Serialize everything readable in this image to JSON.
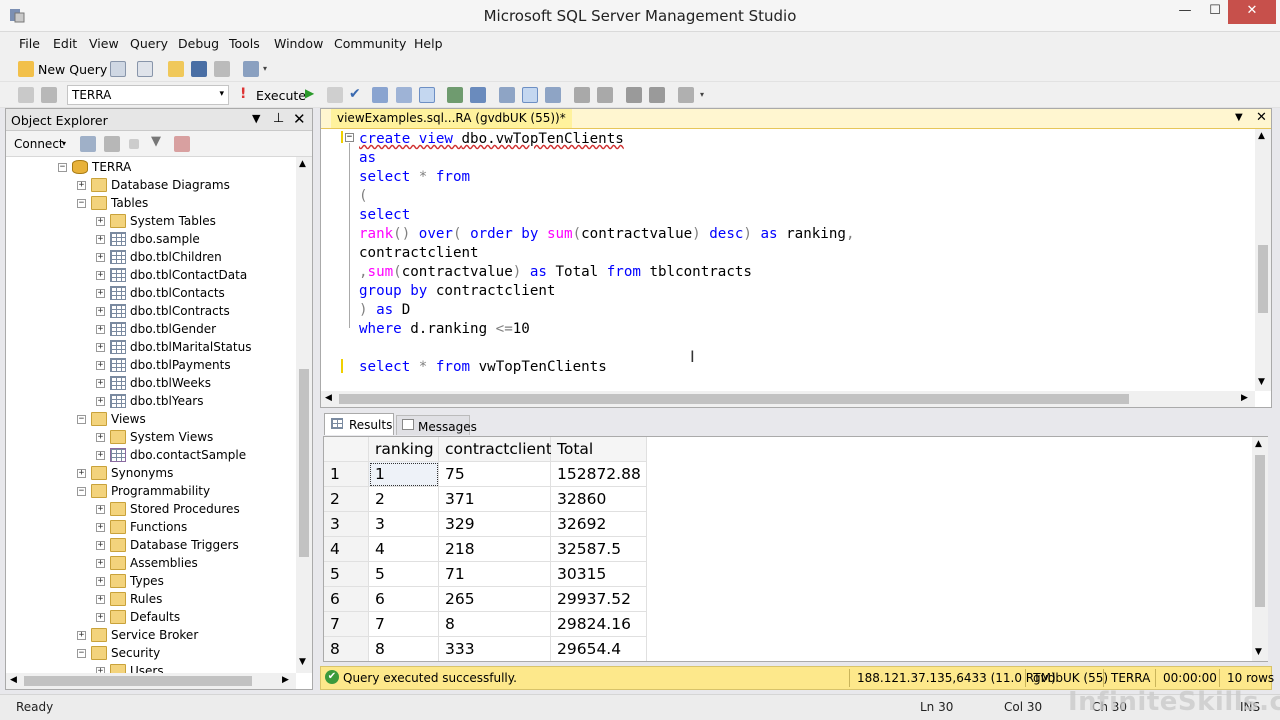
{
  "window": {
    "title": "Microsoft SQL Server Management Studio",
    "min": "—",
    "max": "☐",
    "close": "✕"
  },
  "menu": [
    "File",
    "Edit",
    "View",
    "Query",
    "Debug",
    "Tools",
    "Window",
    "Community",
    "Help"
  ],
  "toolbar": {
    "new_query": "New Query",
    "database": "TERRA",
    "execute": "Execute"
  },
  "object_explorer": {
    "title": "Object Explorer",
    "connect": "Connect",
    "tree": [
      {
        "label": "TERRA",
        "level": 0,
        "exp": "−",
        "icon": "database-icon"
      },
      {
        "label": "Database Diagrams",
        "level": 1,
        "exp": "+",
        "icon": "folder-icon"
      },
      {
        "label": "Tables",
        "level": 1,
        "exp": "−",
        "icon": "folder-icon"
      },
      {
        "label": "System Tables",
        "level": 2,
        "exp": "+",
        "icon": "folder-icon"
      },
      {
        "label": "dbo.sample",
        "level": 2,
        "exp": "+",
        "icon": "table-icon"
      },
      {
        "label": "dbo.tblChildren",
        "level": 2,
        "exp": "+",
        "icon": "table-icon"
      },
      {
        "label": "dbo.tblContactData",
        "level": 2,
        "exp": "+",
        "icon": "table-icon"
      },
      {
        "label": "dbo.tblContacts",
        "level": 2,
        "exp": "+",
        "icon": "table-icon"
      },
      {
        "label": "dbo.tblContracts",
        "level": 2,
        "exp": "+",
        "icon": "table-icon"
      },
      {
        "label": "dbo.tblGender",
        "level": 2,
        "exp": "+",
        "icon": "table-icon"
      },
      {
        "label": "dbo.tblMaritalStatus",
        "level": 2,
        "exp": "+",
        "icon": "table-icon"
      },
      {
        "label": "dbo.tblPayments",
        "level": 2,
        "exp": "+",
        "icon": "table-icon"
      },
      {
        "label": "dbo.tblWeeks",
        "level": 2,
        "exp": "+",
        "icon": "table-icon"
      },
      {
        "label": "dbo.tblYears",
        "level": 2,
        "exp": "+",
        "icon": "table-icon"
      },
      {
        "label": "Views",
        "level": 1,
        "exp": "−",
        "icon": "folder-icon"
      },
      {
        "label": "System Views",
        "level": 2,
        "exp": "+",
        "icon": "folder-icon"
      },
      {
        "label": "dbo.contactSample",
        "level": 2,
        "exp": "+",
        "icon": "view-icon"
      },
      {
        "label": "Synonyms",
        "level": 1,
        "exp": "+",
        "icon": "folder-icon"
      },
      {
        "label": "Programmability",
        "level": 1,
        "exp": "−",
        "icon": "folder-icon"
      },
      {
        "label": "Stored Procedures",
        "level": 2,
        "exp": "+",
        "icon": "folder-icon"
      },
      {
        "label": "Functions",
        "level": 2,
        "exp": "+",
        "icon": "folder-icon"
      },
      {
        "label": "Database Triggers",
        "level": 2,
        "exp": "+",
        "icon": "folder-icon"
      },
      {
        "label": "Assemblies",
        "level": 2,
        "exp": "+",
        "icon": "folder-icon"
      },
      {
        "label": "Types",
        "level": 2,
        "exp": "+",
        "icon": "folder-icon"
      },
      {
        "label": "Rules",
        "level": 2,
        "exp": "+",
        "icon": "folder-icon"
      },
      {
        "label": "Defaults",
        "level": 2,
        "exp": "+",
        "icon": "folder-icon"
      },
      {
        "label": "Service Broker",
        "level": 1,
        "exp": "+",
        "icon": "folder-icon"
      },
      {
        "label": "Security",
        "level": 1,
        "exp": "−",
        "icon": "folder-icon"
      },
      {
        "label": "Users",
        "level": 2,
        "exp": "+",
        "icon": "folder-icon"
      }
    ]
  },
  "editor": {
    "tab_title": "viewExamples.sql...RA (gvdbUK (55))*",
    "code": [
      [
        [
          "kw",
          "create view "
        ],
        [
          "t",
          "dbo.vwTopTenClients"
        ]
      ],
      [
        [
          "kw",
          "as"
        ]
      ],
      [
        [
          "kw",
          "select "
        ],
        [
          "op",
          "* "
        ],
        [
          "kw",
          "from"
        ]
      ],
      [
        [
          "op",
          "("
        ]
      ],
      [
        [
          "kw",
          "select"
        ]
      ],
      [
        [
          "fn",
          "rank"
        ],
        [
          "op",
          "() "
        ],
        [
          "kw",
          "over"
        ],
        [
          "op",
          "( "
        ],
        [
          "kw",
          "order by "
        ],
        [
          "fn",
          "sum"
        ],
        [
          "op",
          "("
        ],
        [
          "t",
          "contractvalue"
        ],
        [
          "op",
          ") "
        ],
        [
          "kw",
          "desc"
        ],
        [
          "op",
          ") "
        ],
        [
          "kw",
          "as "
        ],
        [
          "t",
          "ranking"
        ],
        [
          "op",
          ","
        ]
      ],
      [
        [
          "t",
          "contractclient"
        ]
      ],
      [
        [
          "op",
          ","
        ],
        [
          "fn",
          "sum"
        ],
        [
          "op",
          "("
        ],
        [
          "t",
          "contractvalue"
        ],
        [
          "op",
          ") "
        ],
        [
          "kw",
          "as "
        ],
        [
          "t",
          "Total "
        ],
        [
          "kw",
          "from "
        ],
        [
          "t",
          "tblcontracts"
        ]
      ],
      [
        [
          "kw",
          "group by "
        ],
        [
          "t",
          "contractclient"
        ]
      ],
      [
        [
          "op",
          ") "
        ],
        [
          "kw",
          "as "
        ],
        [
          "t",
          "D"
        ]
      ],
      [
        [
          "kw",
          "where "
        ],
        [
          "t",
          "d.ranking "
        ],
        [
          "op",
          "<="
        ],
        [
          "t",
          "10"
        ]
      ],
      [],
      [
        [
          "kw",
          "select "
        ],
        [
          "op",
          "* "
        ],
        [
          "kw",
          "from "
        ],
        [
          "t",
          "vwTopTenClients"
        ]
      ]
    ]
  },
  "results": {
    "tab_results": "Results",
    "tab_messages": "Messages",
    "columns": [
      "ranking",
      "contractclient",
      "Total"
    ],
    "rows": [
      [
        "1",
        "1",
        "75",
        "152872.88"
      ],
      [
        "2",
        "2",
        "371",
        "32860"
      ],
      [
        "3",
        "3",
        "329",
        "32692"
      ],
      [
        "4",
        "4",
        "218",
        "32587.5"
      ],
      [
        "5",
        "5",
        "71",
        "30315"
      ],
      [
        "6",
        "6",
        "265",
        "29937.52"
      ],
      [
        "7",
        "7",
        "8",
        "29824.16"
      ],
      [
        "8",
        "8",
        "333",
        "29654.4"
      ]
    ]
  },
  "query_status": {
    "message": "Query executed successfully.",
    "server": "188.121.37.135,6433 (11.0 RTM)",
    "login": "gvdbUK (55)",
    "database": "TERRA",
    "time": "00:00:00",
    "rows": "10 rows"
  },
  "statusbar": {
    "ready": "Ready",
    "ln": "Ln 30",
    "col": "Col 30",
    "ch": "Ch 30",
    "ins": "INS"
  },
  "watermark": "InfiniteSkills.com",
  "colors": {
    "keyword": "#0000ff",
    "function": "#ff00ff",
    "operator": "#808080",
    "status_bar": "#fde88b"
  }
}
